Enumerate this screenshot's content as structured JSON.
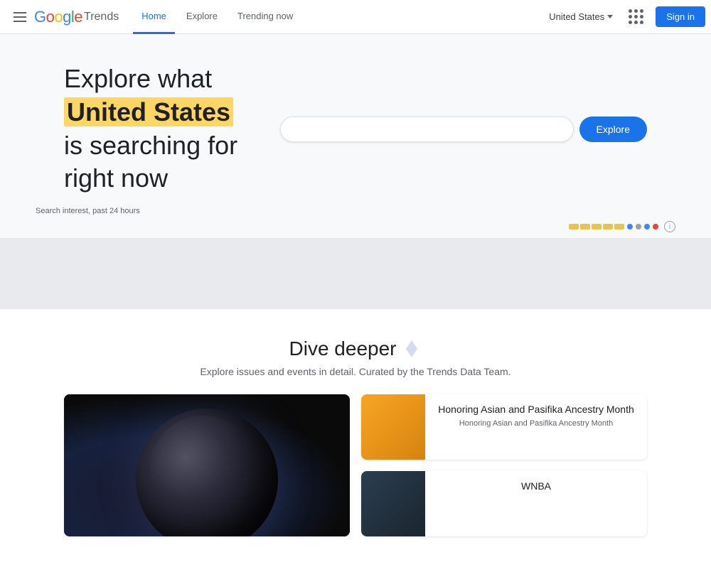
{
  "header": {
    "logo_google": "Google",
    "logo_trends": "Trends",
    "menu_icon_label": "Menu",
    "nav": [
      {
        "id": "home",
        "label": "Home",
        "active": true
      },
      {
        "id": "explore",
        "label": "Explore",
        "active": false
      },
      {
        "id": "trending",
        "label": "Trending now",
        "active": false
      }
    ],
    "region": "United States",
    "sign_in_label": "Sign in"
  },
  "hero": {
    "line1": "Explore what",
    "highlight": "United States",
    "line2": "is searching for",
    "line3": "right now",
    "search_placeholder": "",
    "explore_btn": "Explore"
  },
  "chart": {
    "label": "Search interest, past 24 hours",
    "info_title": "Information"
  },
  "dive_deeper": {
    "title": "Dive deeper",
    "subtitle": "Explore issues and events in detail. Curated by the Trends Data Team.",
    "cards": [
      {
        "id": "space",
        "type": "large",
        "title": ""
      },
      {
        "id": "asian-month",
        "type": "small",
        "title": "Honoring Asian and Pasifika Ancestry Month",
        "description": "Honoring Asian and Pasifika Ancestry Month",
        "img_type": "gold"
      },
      {
        "id": "wnba",
        "type": "small",
        "title": "WNBA",
        "description": "",
        "img_type": "dark"
      }
    ]
  },
  "chart_controls": {
    "bars": [
      "#e8c350",
      "#e8c350",
      "#e8c350",
      "#e8c350",
      "#e8c350"
    ],
    "dots": [
      "#e8c350",
      "#4285f4",
      "#9e9e9e",
      "#4285f4",
      "#ea4335"
    ]
  }
}
